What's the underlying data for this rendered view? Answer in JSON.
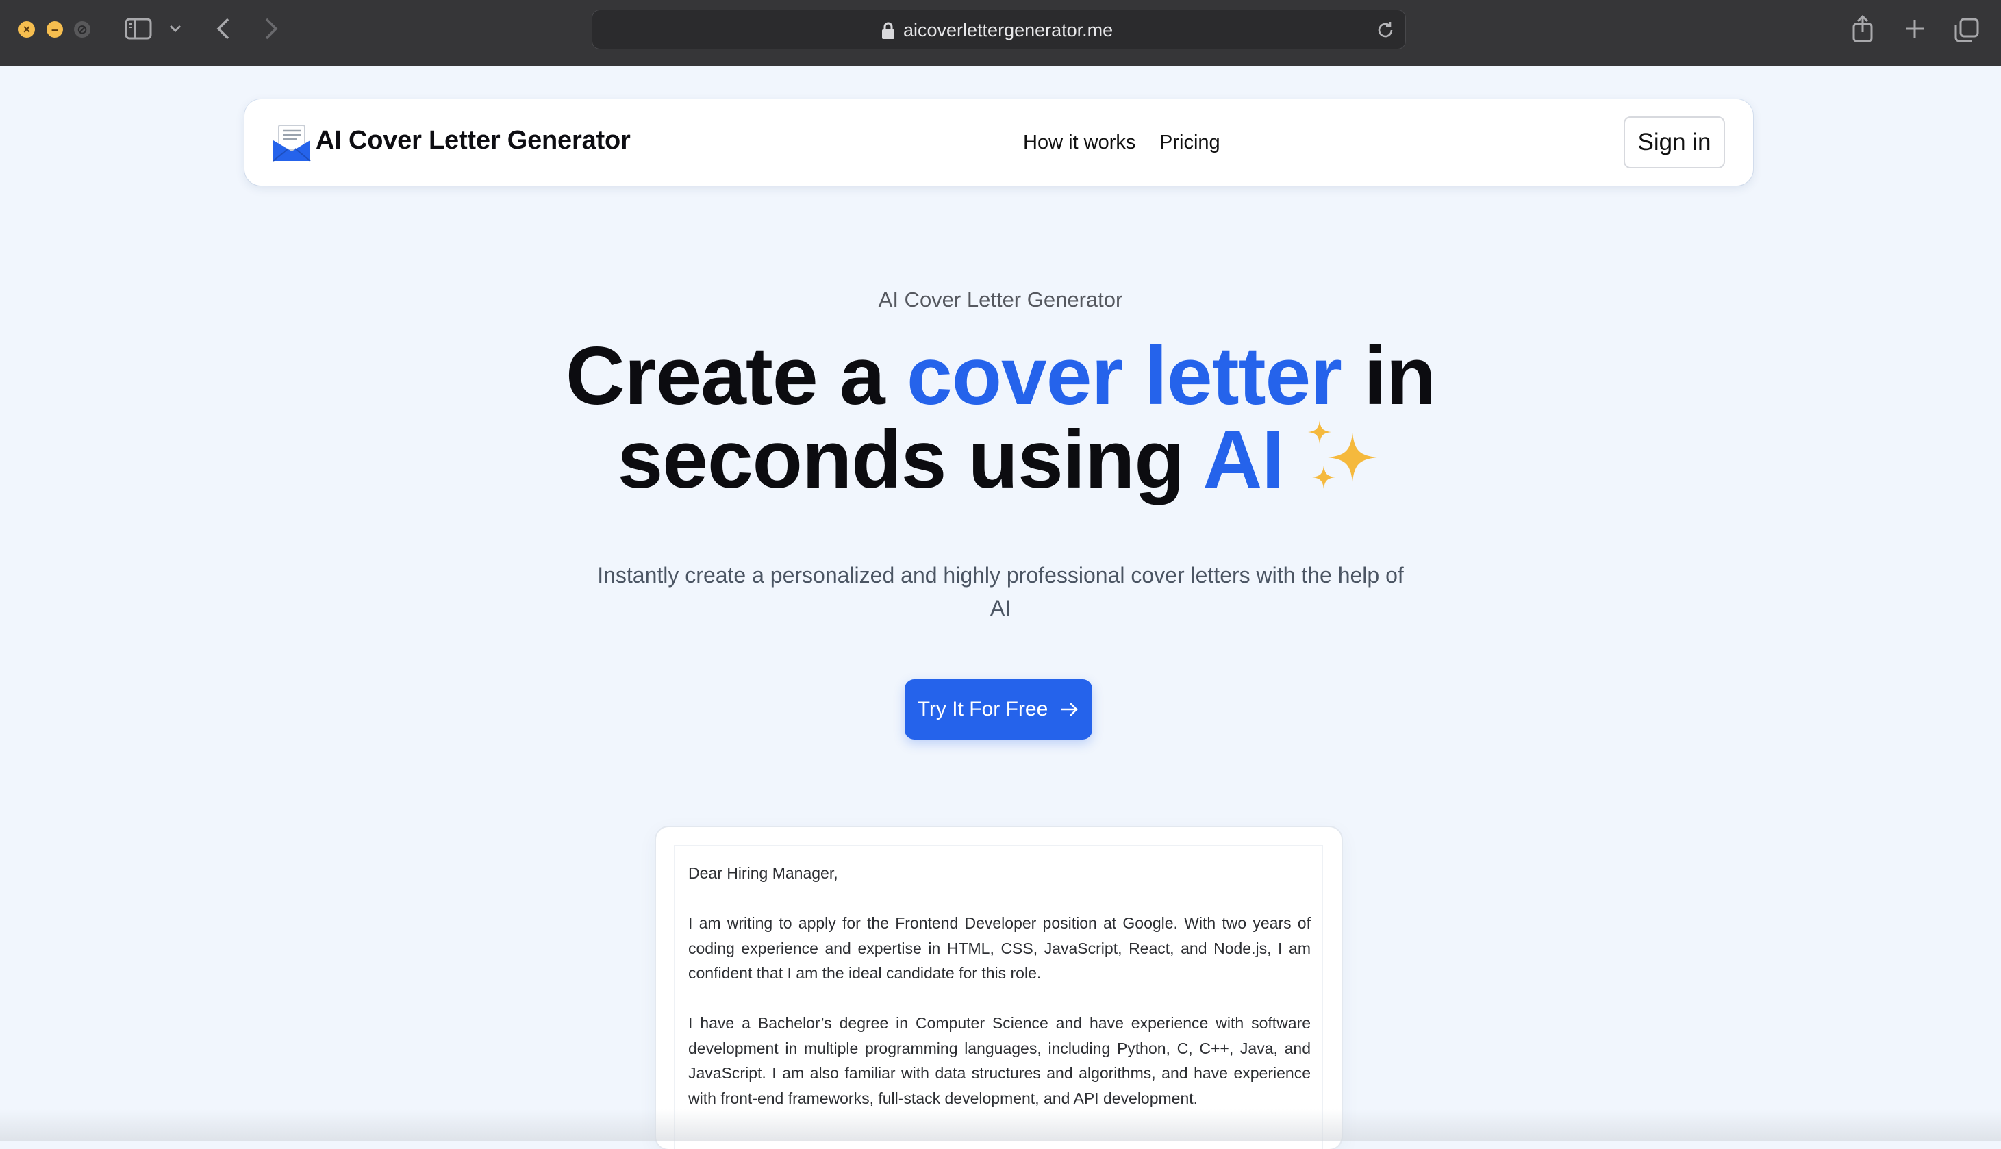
{
  "browser": {
    "url": "aicoverlettergenerator.me"
  },
  "nav": {
    "brand": "AI Cover Letter Generator",
    "links": [
      "How it works",
      "Pricing"
    ],
    "sign_in": "Sign in"
  },
  "hero": {
    "eyebrow": "AI Cover Letter Generator",
    "headline_part1": "Create a ",
    "headline_accent1": "cover letter",
    "headline_part2": " in",
    "headline_part3": "seconds using ",
    "headline_accent2": "AI",
    "subtitle": "Instantly create a personalized and highly professional cover letters with the help of AI",
    "cta": "Try It For Free"
  },
  "letter": {
    "greeting": "Dear Hiring Manager,",
    "paragraph1": "I am writing to apply for the Frontend Developer position at Google. With two years of coding experience and expertise in HTML, CSS, JavaScript, React, and Node.js, I am confident that I am the ideal candidate for this role.",
    "paragraph2": "I have a Bachelor’s degree in Computer Science and have experience with software development in multiple programming languages, including Python, C, C++, Java, and JavaScript. I am also familiar with data structures and algorithms, and have experience with front-end frameworks, full-stack development, and API development."
  },
  "colors": {
    "accent": "#2563eb",
    "background": "#f1f6fd",
    "sparkle": "#f5b93d"
  }
}
